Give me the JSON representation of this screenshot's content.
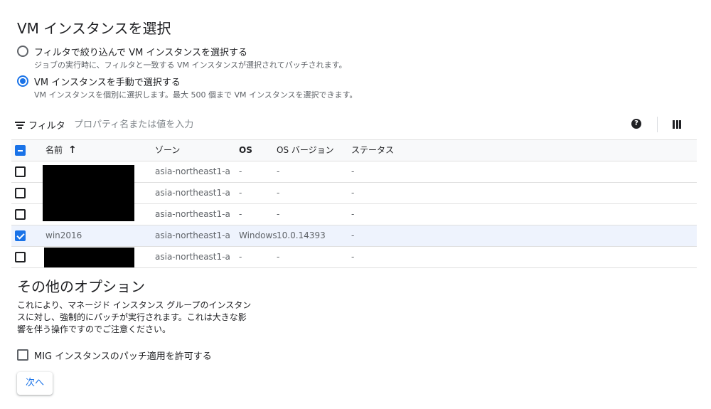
{
  "page": {
    "title": "VM インスタンスを選択"
  },
  "selection_mode": {
    "options": [
      {
        "label": "フィルタで絞り込んで VM インスタンスを選択する",
        "description": "ジョブの実行時に、フィルタと一致する VM インスタンスが選択されてパッチされます。",
        "selected": false
      },
      {
        "label": "VM インスタンスを手動で選択する",
        "description": "VM インスタンスを個別に選択します。最大 500 個まで VM インスタンスを選択できます。",
        "selected": true
      }
    ]
  },
  "filter": {
    "label": "フィルタ",
    "placeholder": "プロパティ名または値を入力",
    "help_icon": "?"
  },
  "table": {
    "columns": [
      "名前",
      "ゾーン",
      "OS",
      "OS バージョン",
      "ステータス"
    ],
    "sort_indicator": "↑",
    "header_checkbox": "indeterminate",
    "rows": [
      {
        "name": "",
        "name_redacted": true,
        "zone": "asia-northeast1-a",
        "os": "-",
        "os_version": "-",
        "status": "-",
        "checked": false
      },
      {
        "name": "",
        "name_redacted": true,
        "zone": "asia-northeast1-a",
        "os": "-",
        "os_version": "-",
        "status": "-",
        "checked": false
      },
      {
        "name": "",
        "name_redacted": true,
        "zone": "asia-northeast1-a",
        "os": "-",
        "os_version": "-",
        "status": "-",
        "checked": false
      },
      {
        "name": "win2016",
        "name_redacted": false,
        "zone": "asia-northeast1-a",
        "os": "Windows",
        "os_version": "10.0.14393",
        "status": "-",
        "checked": true
      },
      {
        "name": "",
        "name_redacted": true,
        "zone": "asia-northeast1-a",
        "os": "-",
        "os_version": "-",
        "status": "-",
        "checked": false
      }
    ]
  },
  "other_options": {
    "title": "その他のオプション",
    "description": "これにより、マネージド インスタンス グループのインスタンスに対し、強制的にパッチが実行されます。これは大きな影響を伴う操作ですのでご注意ください。",
    "mig_checkbox_label": "MIG インスタンスのパッチ適用を許可する",
    "mig_checked": false
  },
  "next_button": "次へ",
  "colors": {
    "accent": "#1a73e8",
    "selected_row": "#eef3fd"
  }
}
